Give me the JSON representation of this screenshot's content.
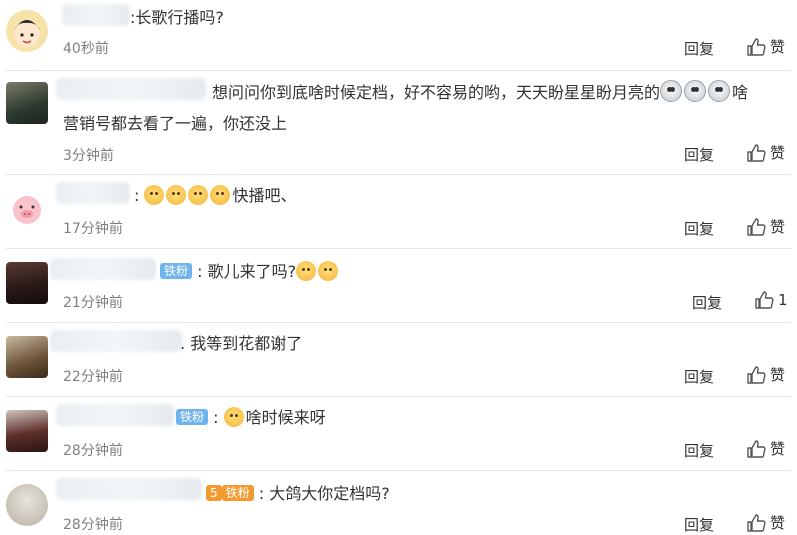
{
  "comments": [
    {
      "text_suffix": "长歌行播吗?",
      "time": "40秒前",
      "reply": "回复",
      "like": "赞"
    },
    {
      "text_line1": "想问问你到底啥时候定档，好不容易的哟，天天盼星星盼月亮的",
      "text_line1_tail": "啥",
      "text_line2": "营销号都去看了一遍，你还没上",
      "time": "3分钟前",
      "reply": "回复",
      "like": "赞"
    },
    {
      "text": "快播吧、",
      "time": "17分钟前",
      "reply": "回复",
      "like": "赞"
    },
    {
      "badge": "铁粉",
      "text": "歌儿来了吗?",
      "time": "21分钟前",
      "reply": "回复",
      "like": "1"
    },
    {
      "text": "我等到花都谢了",
      "time": "22分钟前",
      "reply": "回复",
      "like": "赞"
    },
    {
      "badge": "铁粉",
      "text": "啥时候来呀",
      "time": "28分钟前",
      "reply": "回复",
      "like": "赞"
    },
    {
      "badge_level": "5",
      "badge": "铁粉",
      "text": "大鸽大你定档吗?",
      "time": "28分钟前",
      "reply": "回复",
      "like": "赞"
    }
  ],
  "colors": {
    "text": "#333333",
    "time": "#808080",
    "badge": "#6fb3ee",
    "badge_orange": "#f29a2e",
    "separator": "#e6e6e6"
  },
  "icons": {
    "like": "thumbs-up-icon",
    "emoji": "yellow-dog-emoji",
    "emoji_alt": "shocked-face-emoji"
  }
}
